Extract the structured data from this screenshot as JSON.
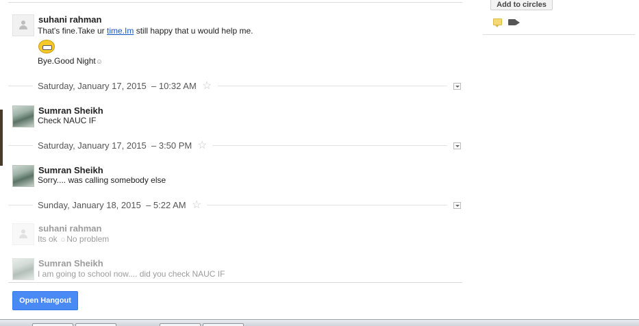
{
  "right_panel": {
    "add_to_circles_label": "Add to circles",
    "icons": [
      "chat-icon",
      "video-icon"
    ]
  },
  "thread": {
    "messages": [
      {
        "sender": "suhani rahman",
        "avatar": "default-person-icon",
        "lines": {
          "line1_before": "That's fine.Take ur ",
          "line1_link": "time.Im",
          "line1_after": " still happy that u would help me.",
          "line3": "Bye.Good Night",
          "line3_smiley": "☺"
        },
        "emoji": "grin-emoji"
      },
      {
        "sender": "Sumran Sheikh",
        "avatar": "photo",
        "text": "Check NAUC IF"
      },
      {
        "sender": "Sumran Sheikh",
        "avatar": "photo",
        "text": "Sorry.... was calling somebody else"
      },
      {
        "sender": "suhani rahman",
        "avatar": "default-person-icon",
        "text_before": "Its ok ",
        "text_smiley": "☺",
        "text_after": "No problem"
      },
      {
        "sender": "Sumran Sheikh",
        "avatar": "photo",
        "text": "I am going to school now.... did you check NAUC IF"
      }
    ],
    "dividers": [
      {
        "date": "Saturday, January 17, 2015",
        "time": "– 10:32 AM"
      },
      {
        "date": "Saturday, January 17, 2015",
        "time": "– 3:50 PM"
      },
      {
        "date": "Sunday, January 18, 2015",
        "time": "– 5:22 AM"
      }
    ]
  },
  "footer": {
    "open_hangout_label": "Open Hangout"
  },
  "colors": {
    "primary_button": "#4a8af4",
    "link": "#1155cc"
  }
}
